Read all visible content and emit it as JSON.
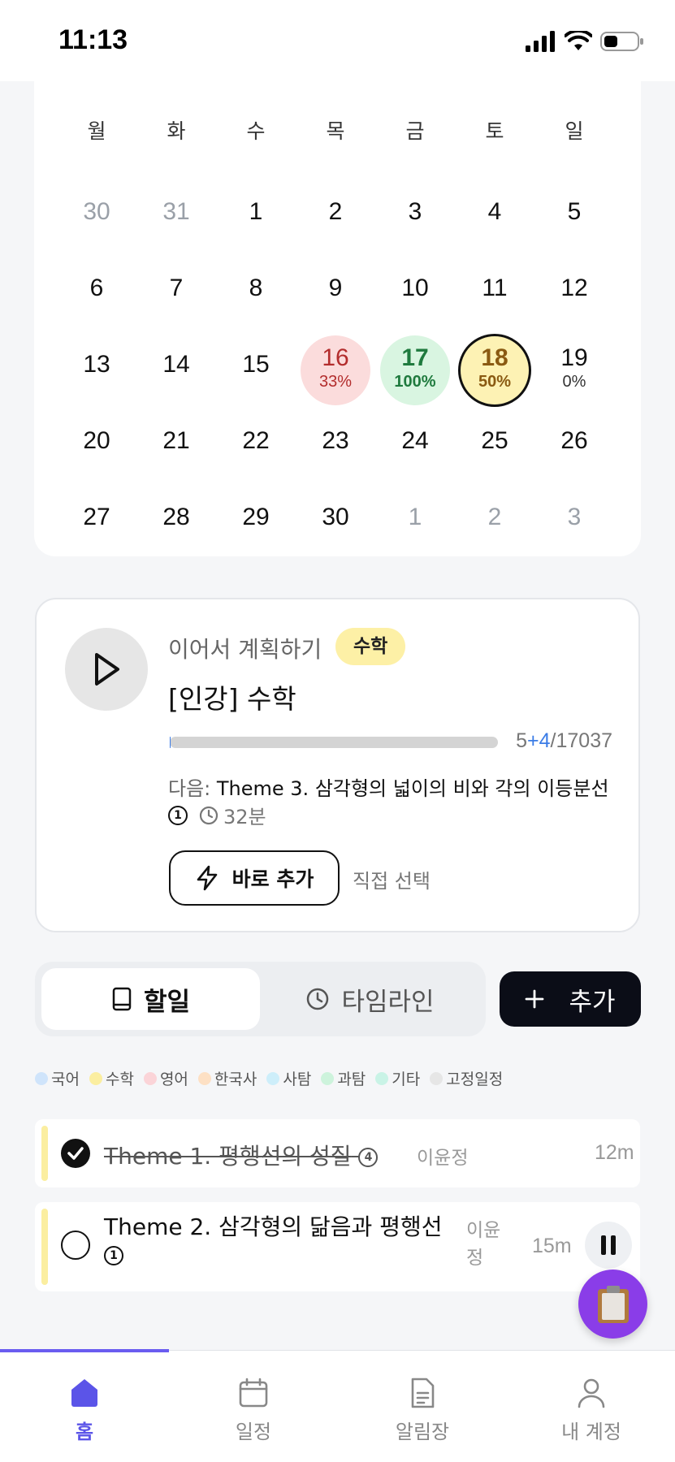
{
  "status": {
    "time": "11:13"
  },
  "calendar": {
    "weekdays": [
      "월",
      "화",
      "수",
      "목",
      "금",
      "토",
      "일"
    ],
    "weeks": [
      [
        {
          "d": "30",
          "muted": true
        },
        {
          "d": "31",
          "muted": true
        },
        {
          "d": "1"
        },
        {
          "d": "2"
        },
        {
          "d": "3"
        },
        {
          "d": "4"
        },
        {
          "d": "5"
        }
      ],
      [
        {
          "d": "6"
        },
        {
          "d": "7"
        },
        {
          "d": "8"
        },
        {
          "d": "9"
        },
        {
          "d": "10"
        },
        {
          "d": "11"
        },
        {
          "d": "12"
        }
      ],
      [
        {
          "d": "13"
        },
        {
          "d": "14"
        },
        {
          "d": "15"
        },
        {
          "d": "16",
          "pct": "33%",
          "status": "low"
        },
        {
          "d": "17",
          "pct": "100%",
          "status": "done"
        },
        {
          "d": "18",
          "pct": "50%",
          "status": "today"
        },
        {
          "d": "19",
          "pct": "0%"
        }
      ],
      [
        {
          "d": "20"
        },
        {
          "d": "21"
        },
        {
          "d": "22"
        },
        {
          "d": "23"
        },
        {
          "d": "24"
        },
        {
          "d": "25"
        },
        {
          "d": "26"
        }
      ],
      [
        {
          "d": "27"
        },
        {
          "d": "28"
        },
        {
          "d": "29"
        },
        {
          "d": "30"
        },
        {
          "d": "1",
          "muted": true
        },
        {
          "d": "2",
          "muted": true
        },
        {
          "d": "3",
          "muted": true
        }
      ]
    ],
    "colors": {
      "low_bg": "#fbdcdc",
      "low_fg": "#b32d2d",
      "done_bg": "#d9f5e1",
      "done_fg": "#1f7a3e",
      "today_bg": "#fdf2b4",
      "today_fg": "#8a5a12"
    }
  },
  "continue": {
    "label": "이어서 계획하기",
    "subject": "수학",
    "title": "[인강] 수학",
    "progress": {
      "done": "5",
      "added": "+4",
      "total": "/17037",
      "fraction": 0.0005
    },
    "next_label": "다음:",
    "next_text": " Theme 3. 삼각형의 넓이의 비와 각의 이등분선",
    "count_badge": "1",
    "duration": "32분",
    "quick_add": "바로 추가",
    "direct_select": "직접 선택"
  },
  "tabs": {
    "todo": "할일",
    "timeline": "타임라인",
    "add": "추가"
  },
  "legend": [
    {
      "label": "국어",
      "color": "#cfe4fb"
    },
    {
      "label": "수학",
      "color": "#fbeea0"
    },
    {
      "label": "영어",
      "color": "#fbd4d8"
    },
    {
      "label": "한국사",
      "color": "#fde0c4"
    },
    {
      "label": "사탐",
      "color": "#cdeefa"
    },
    {
      "label": "과탐",
      "color": "#cdf3dc"
    },
    {
      "label": "기타",
      "color": "#c9f3e6"
    },
    {
      "label": "고정일정",
      "color": "#e6e6e6"
    }
  ],
  "todos": [
    {
      "title": "Theme 1. 평행선의 성질",
      "badge": "4",
      "person": "이윤정",
      "duration": "12m",
      "done": true
    },
    {
      "title": "Theme 2. 삼각형의 닮음과 평행선",
      "badge": "1",
      "person_line1": "이윤",
      "person_line2": "정",
      "duration": "15m",
      "done": false
    }
  ],
  "nav": [
    {
      "label": "홈",
      "icon": "home-icon",
      "active": true
    },
    {
      "label": "일정",
      "icon": "calendar-icon"
    },
    {
      "label": "알림장",
      "icon": "document-icon"
    },
    {
      "label": "내 계정",
      "icon": "user-icon"
    }
  ]
}
